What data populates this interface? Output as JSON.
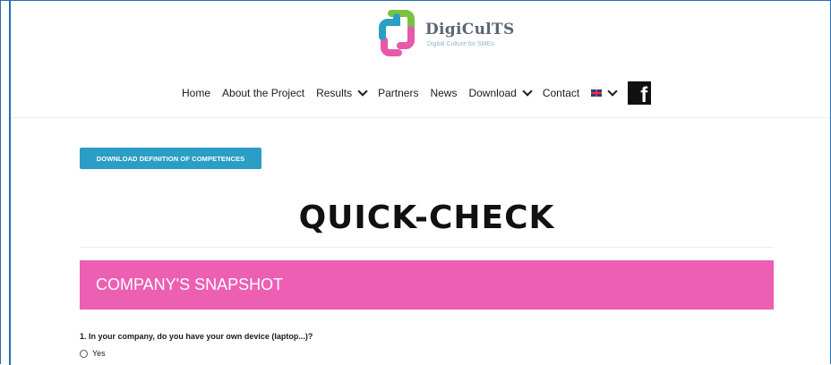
{
  "logo": {
    "title": "DigiCulTS",
    "subtitle": "Digital Culture for SMEs",
    "colors": {
      "pink": "#e75aa8",
      "green": "#7ac143",
      "blue": "#2a9ec4"
    }
  },
  "nav": {
    "items": [
      {
        "label": "Home"
      },
      {
        "label": "About the Project"
      },
      {
        "label": "Results"
      },
      {
        "label": "Partners"
      },
      {
        "label": "News"
      },
      {
        "label": "Download"
      },
      {
        "label": "Contact"
      }
    ],
    "language_icon": "uk-flag-icon",
    "social_icon": "facebook-icon",
    "facebook_glyph": "f"
  },
  "download_button": "DOWNLOAD DEFINITION OF COMPETENCES",
  "page_title": "QUICK-CHECK",
  "section_title": "COMPANY'S SNAPSHOT",
  "question": {
    "text": "1. In your company, do you have your own device (laptop...)?",
    "options": [
      "Yes"
    ]
  },
  "colors": {
    "accent_blue": "#2a9ec4",
    "section_pink": "#ec5fb3",
    "frame_blue": "#2a6db0"
  }
}
